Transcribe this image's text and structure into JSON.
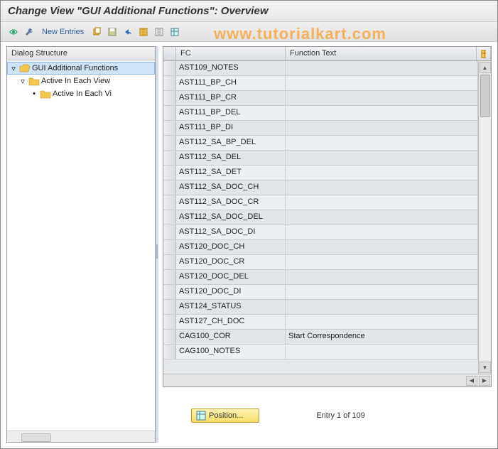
{
  "title": "Change View \"GUI Additional Functions\": Overview",
  "toolbar": {
    "new_entries": "New Entries"
  },
  "watermark": "www.tutorialkart.com",
  "tree": {
    "header": "Dialog Structure",
    "root": "GUI Additional Functions",
    "child1": "Active In Each View",
    "child2": "Active In Each Vi"
  },
  "grid": {
    "col_fc": "FC",
    "col_ft": "Function Text",
    "rows": [
      {
        "fc": "AST109_NOTES",
        "ft": ""
      },
      {
        "fc": "AST111_BP_CH",
        "ft": ""
      },
      {
        "fc": "AST111_BP_CR",
        "ft": ""
      },
      {
        "fc": "AST111_BP_DEL",
        "ft": ""
      },
      {
        "fc": "AST111_BP_DI",
        "ft": ""
      },
      {
        "fc": "AST112_SA_BP_DEL",
        "ft": ""
      },
      {
        "fc": "AST112_SA_DEL",
        "ft": ""
      },
      {
        "fc": "AST112_SA_DET",
        "ft": ""
      },
      {
        "fc": "AST112_SA_DOC_CH",
        "ft": ""
      },
      {
        "fc": "AST112_SA_DOC_CR",
        "ft": ""
      },
      {
        "fc": "AST112_SA_DOC_DEL",
        "ft": ""
      },
      {
        "fc": "AST112_SA_DOC_DI",
        "ft": ""
      },
      {
        "fc": "AST120_DOC_CH",
        "ft": ""
      },
      {
        "fc": "AST120_DOC_CR",
        "ft": ""
      },
      {
        "fc": "AST120_DOC_DEL",
        "ft": ""
      },
      {
        "fc": "AST120_DOC_DI",
        "ft": ""
      },
      {
        "fc": "AST124_STATUS",
        "ft": ""
      },
      {
        "fc": "AST127_CH_DOC",
        "ft": ""
      },
      {
        "fc": "CAG100_COR",
        "ft": "Start Correspondence"
      },
      {
        "fc": "CAG100_NOTES",
        "ft": ""
      }
    ]
  },
  "footer": {
    "position_label": "Position...",
    "entry_text": "Entry 1 of 109"
  }
}
